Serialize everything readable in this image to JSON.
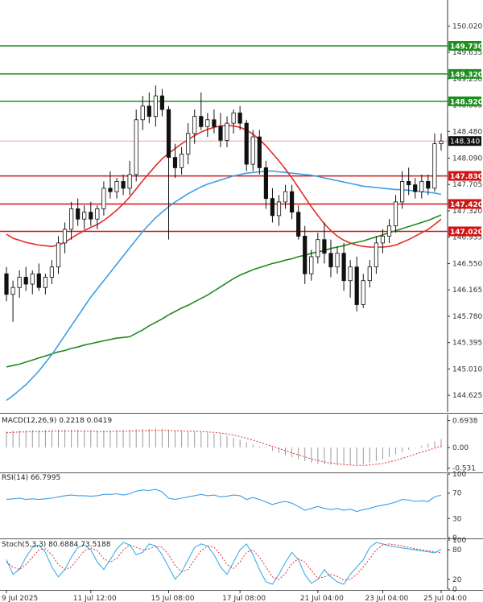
{
  "chart_data": [
    {
      "type": "candlestick",
      "panel": "price",
      "ylim": [
        144.38,
        150.4
      ],
      "y_ticks": [
        "150.020",
        "149.635",
        "149.250",
        "148.865",
        "148.480",
        "148.090",
        "147.705",
        "147.320",
        "146.935",
        "146.550",
        "146.165",
        "145.780",
        "145.395",
        "145.010",
        "144.625"
      ],
      "levels": [
        {
          "label": "149.730",
          "value": 149.73,
          "color": "#1e8f1e"
        },
        {
          "label": "149.320",
          "value": 149.32,
          "color": "#1e8f1e"
        },
        {
          "label": "148.920",
          "value": 148.92,
          "color": "#1e8f1e"
        },
        {
          "label": "147.830",
          "value": 147.83,
          "color": "#d11414"
        },
        {
          "label": "147.420",
          "value": 147.42,
          "color": "#d11414"
        },
        {
          "label": "147.020",
          "value": 147.02,
          "color": "#d11414"
        }
      ],
      "current_price": {
        "label": "148.340",
        "value": 148.34
      },
      "candles": [
        [
          146.4,
          146.5,
          146.0,
          146.1
        ],
        [
          146.1,
          146.3,
          145.7,
          146.2
        ],
        [
          146.2,
          146.45,
          146.05,
          146.35
        ],
        [
          146.35,
          146.5,
          146.15,
          146.25
        ],
        [
          146.25,
          146.45,
          146.1,
          146.4
        ],
        [
          146.4,
          146.55,
          146.15,
          146.2
        ],
        [
          146.2,
          146.4,
          146.1,
          146.35
        ],
        [
          146.35,
          146.6,
          146.25,
          146.5
        ],
        [
          146.5,
          146.95,
          146.4,
          146.85
        ],
        [
          146.85,
          147.15,
          146.7,
          147.05
        ],
        [
          147.05,
          147.45,
          146.9,
          147.35
        ],
        [
          147.35,
          147.5,
          147.1,
          147.2
        ],
        [
          147.2,
          147.4,
          147.05,
          147.3
        ],
        [
          147.3,
          147.45,
          147.1,
          147.2
        ],
        [
          147.2,
          147.4,
          147.05,
          147.35
        ],
        [
          147.35,
          147.75,
          147.25,
          147.65
        ],
        [
          147.65,
          147.9,
          147.5,
          147.6
        ],
        [
          147.6,
          147.8,
          147.5,
          147.75
        ],
        [
          147.75,
          147.85,
          147.55,
          147.65
        ],
        [
          147.65,
          148.05,
          147.55,
          147.85
        ],
        [
          147.85,
          148.8,
          147.75,
          148.65
        ],
        [
          148.65,
          149.0,
          148.5,
          148.85
        ],
        [
          148.85,
          149.05,
          148.6,
          148.7
        ],
        [
          148.7,
          149.15,
          148.55,
          149.0
        ],
        [
          149.0,
          149.1,
          148.7,
          148.8
        ],
        [
          148.8,
          148.85,
          146.9,
          148.1
        ],
        [
          148.1,
          148.3,
          147.8,
          147.95
        ],
        [
          147.95,
          148.25,
          147.85,
          148.15
        ],
        [
          148.15,
          148.6,
          148.0,
          148.45
        ],
        [
          148.45,
          148.8,
          148.3,
          148.7
        ],
        [
          148.7,
          149.05,
          148.5,
          148.55
        ],
        [
          148.55,
          148.75,
          148.4,
          148.65
        ],
        [
          148.65,
          148.8,
          148.45,
          148.55
        ],
        [
          148.55,
          148.75,
          148.25,
          148.35
        ],
        [
          148.35,
          148.7,
          148.25,
          148.6
        ],
        [
          148.6,
          148.8,
          148.45,
          148.75
        ],
        [
          148.75,
          148.85,
          148.5,
          148.6
        ],
        [
          148.6,
          148.65,
          147.9,
          148.0
        ],
        [
          148.0,
          148.5,
          147.9,
          148.4
        ],
        [
          148.4,
          148.5,
          147.85,
          147.95
        ],
        [
          147.95,
          148.05,
          147.35,
          147.5
        ],
        [
          147.5,
          147.65,
          147.15,
          147.25
        ],
        [
          147.25,
          147.55,
          147.1,
          147.45
        ],
        [
          147.45,
          147.7,
          147.35,
          147.6
        ],
        [
          147.6,
          147.7,
          147.2,
          147.3
        ],
        [
          147.3,
          147.4,
          146.9,
          146.95
        ],
        [
          146.95,
          147.1,
          146.25,
          146.4
        ],
        [
          146.4,
          146.75,
          146.3,
          146.65
        ],
        [
          146.65,
          147.0,
          146.55,
          146.9
        ],
        [
          146.9,
          147.15,
          146.55,
          146.7
        ],
        [
          146.7,
          146.9,
          146.35,
          146.5
        ],
        [
          146.5,
          146.8,
          146.4,
          146.7
        ],
        [
          146.7,
          146.85,
          146.15,
          146.3
        ],
        [
          146.3,
          146.6,
          146.05,
          146.5
        ],
        [
          146.5,
          146.65,
          145.85,
          145.95
        ],
        [
          145.95,
          146.4,
          145.9,
          146.3
        ],
        [
          146.3,
          146.6,
          146.2,
          146.5
        ],
        [
          146.5,
          146.95,
          146.4,
          146.85
        ],
        [
          146.85,
          147.05,
          146.7,
          146.95
        ],
        [
          146.95,
          147.2,
          146.85,
          147.1
        ],
        [
          147.1,
          147.55,
          147.0,
          147.45
        ],
        [
          147.45,
          147.9,
          147.35,
          147.75
        ],
        [
          147.75,
          147.95,
          147.55,
          147.7
        ],
        [
          147.7,
          147.8,
          147.5,
          147.6
        ],
        [
          147.6,
          147.85,
          147.5,
          147.75
        ],
        [
          147.75,
          147.85,
          147.55,
          147.65
        ],
        [
          147.65,
          148.45,
          147.6,
          148.3
        ],
        [
          148.3,
          148.45,
          148.2,
          148.34
        ]
      ],
      "sma_red": [
        146.98,
        146.92,
        146.89,
        146.86,
        146.84,
        146.82,
        146.81,
        146.8,
        146.82,
        146.86,
        146.92,
        146.98,
        147.03,
        147.08,
        147.12,
        147.18,
        147.25,
        147.33,
        147.42,
        147.52,
        147.64,
        147.76,
        147.87,
        147.98,
        148.08,
        148.16,
        148.23,
        148.3,
        148.36,
        148.42,
        148.47,
        148.51,
        148.54,
        148.56,
        148.57,
        148.56,
        148.54,
        148.5,
        148.44,
        148.36,
        148.27,
        148.16,
        148.05,
        147.93,
        147.8,
        147.66,
        147.52,
        147.38,
        147.25,
        147.13,
        147.03,
        146.95,
        146.89,
        146.85,
        146.82,
        146.8,
        146.79,
        146.79,
        146.79,
        146.8,
        146.82,
        146.86,
        146.9,
        146.95,
        147.0,
        147.05,
        147.12,
        147.2
      ],
      "sma_blue": [
        144.55,
        144.62,
        144.7,
        144.78,
        144.88,
        144.98,
        145.1,
        145.22,
        145.36,
        145.5,
        145.64,
        145.78,
        145.92,
        146.06,
        146.18,
        146.3,
        146.42,
        146.54,
        146.66,
        146.78,
        146.9,
        147.02,
        147.12,
        147.22,
        147.3,
        147.38,
        147.45,
        147.51,
        147.57,
        147.62,
        147.67,
        147.71,
        147.74,
        147.77,
        147.8,
        147.83,
        147.85,
        147.87,
        147.88,
        147.89,
        147.9,
        147.9,
        147.89,
        147.88,
        147.87,
        147.86,
        147.85,
        147.84,
        147.82,
        147.8,
        147.78,
        147.76,
        147.74,
        147.72,
        147.7,
        147.68,
        147.67,
        147.66,
        147.65,
        147.64,
        147.63,
        147.63,
        147.62,
        147.61,
        147.6,
        147.59,
        147.58,
        147.56
      ],
      "sma_green": [
        145.04,
        145.06,
        145.08,
        145.11,
        145.14,
        145.17,
        145.2,
        145.23,
        145.26,
        145.28,
        145.31,
        145.33,
        145.36,
        145.38,
        145.4,
        145.42,
        145.44,
        145.46,
        145.47,
        145.48,
        145.53,
        145.58,
        145.64,
        145.69,
        145.74,
        145.8,
        145.85,
        145.9,
        145.94,
        145.99,
        146.04,
        146.09,
        146.15,
        146.21,
        146.27,
        146.33,
        146.38,
        146.42,
        146.46,
        146.49,
        146.52,
        146.55,
        146.57,
        146.6,
        146.62,
        146.65,
        146.67,
        146.7,
        146.72,
        146.74,
        146.77,
        146.79,
        146.81,
        146.84,
        146.86,
        146.88,
        146.91,
        146.94,
        146.97,
        147.0,
        147.03,
        147.06,
        147.09,
        147.12,
        147.15,
        147.18,
        147.22,
        147.26
      ],
      "x_ticks": [
        "9 Jul 2025",
        "11 Jul 12:00",
        "15 Jul 08:00",
        "17 Jul 08:00",
        "21 Jul 04:00",
        "23 Jul 04:00",
        "25 Jul 04:00"
      ],
      "x_tick_index": [
        0,
        13,
        25,
        36,
        48,
        58,
        67
      ]
    },
    {
      "type": "bar",
      "panel": "macd",
      "label": "MACD(12,26,9) 0.2218 0.0419",
      "ylim": [
        -0.62,
        0.85
      ],
      "y_ticks": [
        "0.6938",
        "0.00",
        "-0.531"
      ],
      "y_tick_values": [
        0.6938,
        0.0,
        -0.531
      ],
      "histogram": [
        0.42,
        0.43,
        0.44,
        0.44,
        0.45,
        0.45,
        0.45,
        0.45,
        0.46,
        0.46,
        0.46,
        0.46,
        0.45,
        0.45,
        0.44,
        0.44,
        0.44,
        0.45,
        0.45,
        0.46,
        0.47,
        0.48,
        0.48,
        0.49,
        0.48,
        0.46,
        0.44,
        0.43,
        0.42,
        0.41,
        0.4,
        0.38,
        0.36,
        0.34,
        0.3,
        0.25,
        0.2,
        0.14,
        0.08,
        0.03,
        -0.02,
        -0.08,
        -0.14,
        -0.2,
        -0.25,
        -0.3,
        -0.35,
        -0.39,
        -0.42,
        -0.43,
        -0.44,
        -0.45,
        -0.45,
        -0.45,
        -0.44,
        -0.42,
        -0.39,
        -0.35,
        -0.3,
        -0.24,
        -0.18,
        -0.12,
        -0.06,
        -0.01,
        0.05,
        0.1,
        0.16,
        0.22
      ],
      "signal": [
        0.38,
        0.39,
        0.4,
        0.4,
        0.41,
        0.41,
        0.41,
        0.42,
        0.42,
        0.42,
        0.42,
        0.42,
        0.42,
        0.42,
        0.41,
        0.41,
        0.41,
        0.42,
        0.42,
        0.42,
        0.43,
        0.43,
        0.44,
        0.44,
        0.44,
        0.44,
        0.43,
        0.43,
        0.42,
        0.42,
        0.41,
        0.4,
        0.39,
        0.37,
        0.35,
        0.32,
        0.28,
        0.24,
        0.19,
        0.14,
        0.08,
        0.03,
        -0.03,
        -0.08,
        -0.14,
        -0.19,
        -0.24,
        -0.29,
        -0.33,
        -0.37,
        -0.4,
        -0.42,
        -0.44,
        -0.45,
        -0.46,
        -0.46,
        -0.45,
        -0.43,
        -0.41,
        -0.37,
        -0.33,
        -0.28,
        -0.23,
        -0.17,
        -0.12,
        -0.07,
        -0.02,
        0.04
      ]
    },
    {
      "type": "line",
      "panel": "rsi",
      "label": "RSI(14) 66.7995",
      "ylim": [
        0,
        100
      ],
      "y_ticks": [
        "100",
        "70",
        "30",
        "0"
      ],
      "y_tick_values": [
        100,
        70,
        30,
        0
      ],
      "values": [
        60,
        61,
        62,
        60,
        61,
        60,
        61,
        62,
        64,
        66,
        67,
        66,
        66,
        65,
        66,
        68,
        68,
        69,
        67,
        69,
        73,
        75,
        74,
        76,
        72,
        62,
        60,
        62,
        64,
        66,
        68,
        66,
        67,
        64,
        65,
        67,
        66,
        60,
        63,
        60,
        56,
        52,
        55,
        57,
        54,
        49,
        43,
        46,
        49,
        46,
        44,
        46,
        43,
        45,
        41,
        44,
        46,
        49,
        51,
        53,
        56,
        60,
        59,
        57,
        58,
        57,
        64,
        67
      ]
    },
    {
      "type": "line",
      "panel": "stoch",
      "label": "Stoch(5,3,3) 80.6884 73.5188",
      "ylim": [
        0,
        100
      ],
      "y_ticks": [
        "100",
        "80",
        "20",
        "0"
      ],
      "y_tick_values": [
        100,
        80,
        20,
        0
      ],
      "k": [
        60,
        30,
        40,
        65,
        85,
        90,
        75,
        45,
        25,
        40,
        65,
        85,
        90,
        80,
        55,
        40,
        60,
        82,
        95,
        90,
        70,
        75,
        92,
        88,
        70,
        45,
        20,
        35,
        60,
        85,
        92,
        88,
        70,
        45,
        30,
        55,
        80,
        92,
        70,
        40,
        15,
        10,
        30,
        55,
        75,
        60,
        30,
        12,
        20,
        40,
        25,
        15,
        10,
        30,
        45,
        60,
        85,
        95,
        92,
        88,
        86,
        84,
        82,
        80,
        78,
        76,
        74,
        81
      ],
      "d": [
        55,
        45,
        40,
        50,
        65,
        80,
        82,
        70,
        50,
        40,
        45,
        62,
        78,
        84,
        78,
        62,
        55,
        62,
        80,
        90,
        85,
        80,
        82,
        87,
        85,
        70,
        48,
        35,
        40,
        60,
        78,
        88,
        85,
        70,
        50,
        42,
        55,
        75,
        80,
        65,
        45,
        25,
        20,
        32,
        52,
        62,
        55,
        38,
        22,
        25,
        30,
        26,
        18,
        20,
        30,
        45,
        62,
        80,
        90,
        92,
        90,
        88,
        85,
        82,
        80,
        78,
        76,
        74
      ]
    }
  ]
}
